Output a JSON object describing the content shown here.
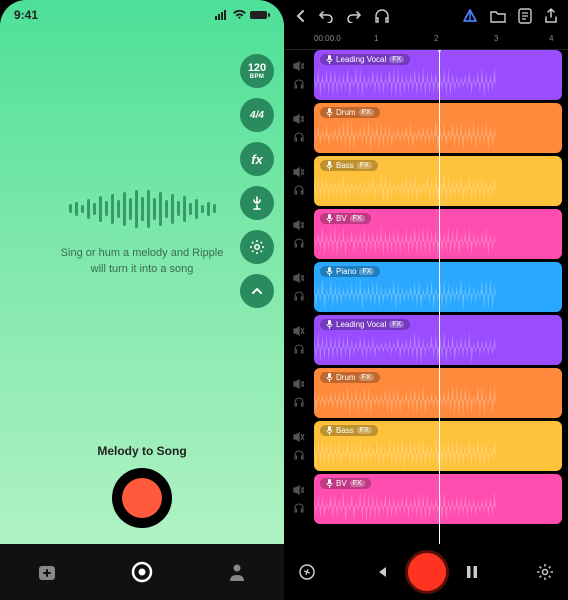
{
  "left": {
    "status_time": "9:41",
    "hint_line1": "Sing or hum a melody and Ripple",
    "hint_line2": "will turn it into a song",
    "record_label": "Melody to Song",
    "pills": {
      "bpm_value": "120",
      "bpm_label": "BPM",
      "time_sig": "4/4",
      "fx": "fx"
    }
  },
  "right": {
    "ruler_start": "00:00.0",
    "ticks": [
      "1",
      "2",
      "3",
      "4"
    ],
    "tracks": [
      {
        "name": "Leading Vocal",
        "fx": "FX",
        "color": "#9a4dff"
      },
      {
        "name": "Drum",
        "fx": "FX",
        "color": "#ff8a3c"
      },
      {
        "name": "Bass",
        "fx": "FX",
        "color": "#ffc23c"
      },
      {
        "name": "BV",
        "fx": "FX",
        "color": "#ff4db0"
      },
      {
        "name": "Piano",
        "fx": "FX",
        "color": "#2aa8ff"
      },
      {
        "name": "Leading Vocal",
        "fx": "FX",
        "color": "#9a4dff"
      },
      {
        "name": "Drum",
        "fx": "FX",
        "color": "#ff8a3c"
      },
      {
        "name": "Bass",
        "fx": "FX",
        "color": "#ffc23c"
      },
      {
        "name": "BV",
        "fx": "FX",
        "color": "#ff4db0"
      }
    ]
  }
}
